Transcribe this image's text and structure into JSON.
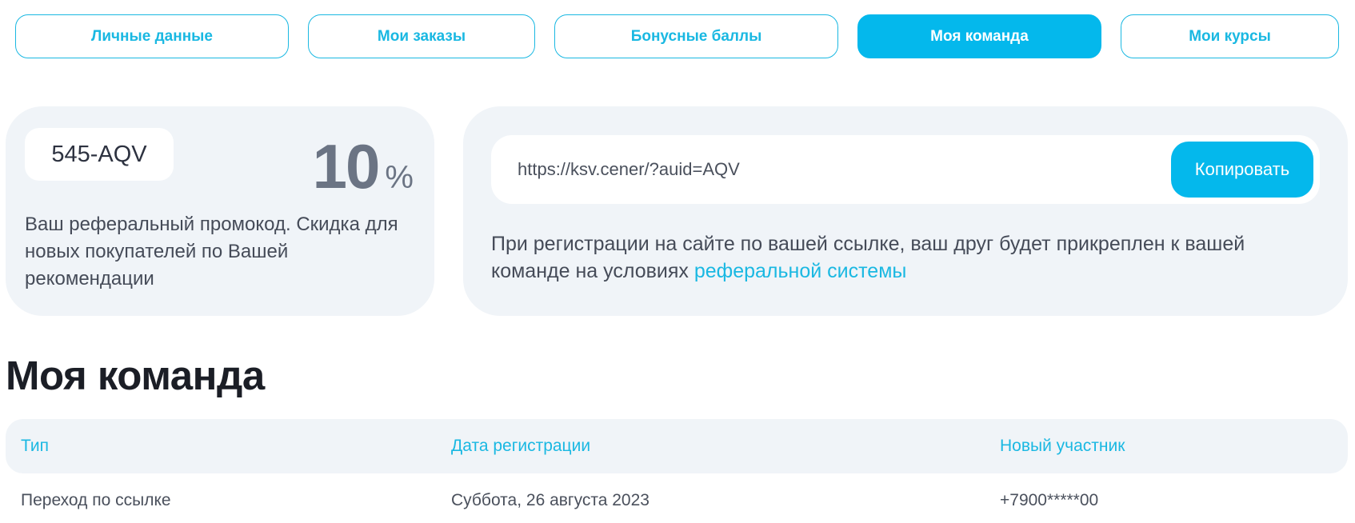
{
  "tabs": [
    {
      "label": "Личные данные",
      "active": false
    },
    {
      "label": "Мои заказы",
      "active": false
    },
    {
      "label": "Бонусные баллы",
      "active": false
    },
    {
      "label": "Моя команда",
      "active": true
    },
    {
      "label": "Мои курсы",
      "active": false
    }
  ],
  "promo": {
    "code": "545-AQV",
    "discount_value": "10",
    "discount_unit": "%",
    "description": "Ваш реферальный промокод. Скидка для новых покупателей по Вашей рекомендации"
  },
  "referral": {
    "link": "https://ksv.cener/?auid=AQV",
    "copy_label": "Копировать",
    "description_text": "При регистрации на сайте по вашей ссылке, ваш друг будет прикреплен к вашей команде на условиях ",
    "description_link": "реферальной системы"
  },
  "team": {
    "title": "Моя команда",
    "columns": [
      "Тип",
      "Дата регистрации",
      "Новый участник"
    ],
    "rows": [
      [
        "Переход по ссылке",
        "Суббота, 26 августа 2023",
        "+7900*****00"
      ]
    ]
  },
  "colors": {
    "accent": "#04b8ec",
    "card_bg": "#f0f4f8",
    "text": "#454b58",
    "heading": "#1b1e26"
  }
}
